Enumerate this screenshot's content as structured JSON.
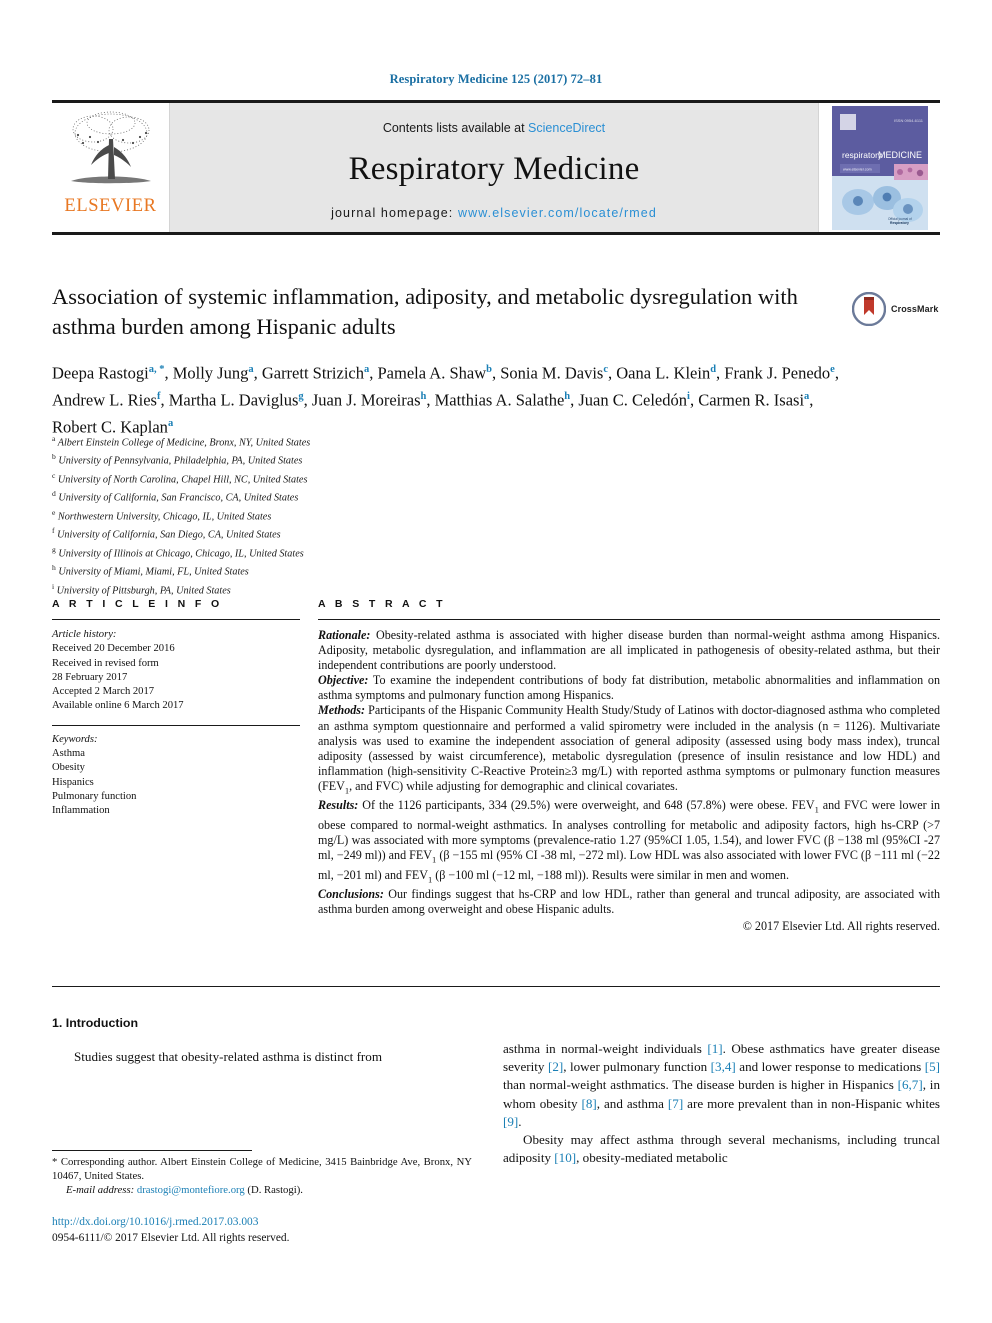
{
  "running_head": "Respiratory Medicine 125 (2017) 72–81",
  "masthead": {
    "publisher_word": "ELSEVIER",
    "contents_prefix": "Contents lists available at ",
    "contents_link": "ScienceDirect",
    "journal_title": "Respiratory Medicine",
    "homepage_prefix": "journal homepage: ",
    "homepage_url": "www.elsevier.com/locate/rmed",
    "cover_title": "respiratory MEDICINE",
    "colors": {
      "elsevier_orange": "#E87722",
      "link_blue": "#2a8fd4",
      "masthead_bg": "#e6e6e6",
      "cover_purple": "#5c5ca0"
    }
  },
  "article": {
    "title": "Association of systemic inflammation, adiposity, and metabolic dysregulation with asthma burden among Hispanic adults",
    "crossmark_label": "CrossMark",
    "authors": [
      {
        "name": "Deepa Rastogi",
        "sup": "a, *"
      },
      {
        "name": "Molly Jung",
        "sup": "a"
      },
      {
        "name": "Garrett Strizich",
        "sup": "a"
      },
      {
        "name": "Pamela A. Shaw",
        "sup": "b"
      },
      {
        "name": "Sonia M. Davis",
        "sup": "c"
      },
      {
        "name": "Oana L. Klein",
        "sup": "d"
      },
      {
        "name": "Frank J. Penedo",
        "sup": "e"
      },
      {
        "name": "Andrew L. Ries",
        "sup": "f"
      },
      {
        "name": "Martha L. Daviglus",
        "sup": "g"
      },
      {
        "name": "Juan J. Moreiras",
        "sup": "h"
      },
      {
        "name": "Matthias A. Salathe",
        "sup": "h"
      },
      {
        "name": "Juan C. Celedón",
        "sup": "i"
      },
      {
        "name": "Carmen R. Isasi",
        "sup": "a"
      },
      {
        "name": "Robert C. Kaplan",
        "sup": "a"
      }
    ],
    "affiliations": [
      {
        "mark": "a",
        "text": "Albert Einstein College of Medicine, Bronx, NY, United States"
      },
      {
        "mark": "b",
        "text": "University of Pennsylvania, Philadelphia, PA, United States"
      },
      {
        "mark": "c",
        "text": "University of North Carolina, Chapel Hill, NC, United States"
      },
      {
        "mark": "d",
        "text": "University of California, San Francisco, CA, United States"
      },
      {
        "mark": "e",
        "text": "Northwestern University, Chicago, IL, United States"
      },
      {
        "mark": "f",
        "text": "University of California, San Diego, CA, United States"
      },
      {
        "mark": "g",
        "text": "University of Illinois at Chicago, Chicago, IL, United States"
      },
      {
        "mark": "h",
        "text": "University of Miami, Miami, FL, United States"
      },
      {
        "mark": "i",
        "text": "University of Pittsburgh, PA, United States"
      }
    ]
  },
  "article_info": {
    "heading": "A R T I C L E  I N F O",
    "history_label": "Article history:",
    "history": [
      "Received 20 December 2016",
      "Received in revised form",
      "28 February 2017",
      "Accepted 2 March 2017",
      "Available online 6 March 2017"
    ],
    "keywords_label": "Keywords:",
    "keywords": [
      "Asthma",
      "Obesity",
      "Hispanics",
      "Pulmonary function",
      "Inflammation"
    ]
  },
  "abstract": {
    "heading": "A B S T R A C T",
    "sections": [
      {
        "lead": "Rationale:",
        "text": " Obesity-related asthma is associated with higher disease burden than normal-weight asthma among Hispanics. Adiposity, metabolic dysregulation, and inflammation are all implicated in pathogenesis of obesity-related asthma, but their independent contributions are poorly understood."
      },
      {
        "lead": "Objective:",
        "text": " To examine the independent contributions of body fat distribution, metabolic abnormalities and inflammation on asthma symptoms and pulmonary function among Hispanics."
      },
      {
        "lead": "Methods:",
        "text": " Participants of the Hispanic Community Health Study/Study of Latinos with doctor-diagnosed asthma who completed an asthma symptom questionnaire and performed a valid spirometry were included in the analysis (n = 1126). Multivariate analysis was used to examine the independent association of general adiposity (assessed using body mass index), truncal adiposity (assessed by waist circumference), metabolic dysregulation (presence of insulin resistance and low HDL) and inflammation (high-sensitivity C-Reactive Protein≥3 mg/L) with reported asthma symptoms or pulmonary function measures (FEV1, and FVC) while adjusting for demographic and clinical covariates."
      },
      {
        "lead": "Results:",
        "text": " Of the 1126 participants, 334 (29.5%) were overweight, and 648 (57.8%) were obese. FEV1 and FVC were lower in obese compared to normal-weight asthmatics. In analyses controlling for metabolic and adiposity factors, high hs-CRP (>7 mg/L) was associated with more symptoms (prevalence-ratio 1.27 (95%CI 1.05, 1.54), and lower FVC (β −138 ml (95%CI -27 ml, −249 ml)) and FEV1 (β −155 ml (95% CI -38 ml, −272 ml). Low HDL was also associated with lower FVC (β −111 ml (−22 ml, −201 ml) and FEV1 (β −100 ml (−12 ml, −188 ml)). Results were similar in men and women."
      },
      {
        "lead": "Conclusions:",
        "text": " Our findings suggest that hs-CRP and low HDL, rather than general and truncal adiposity, are associated with asthma burden among overweight and obese Hispanic adults."
      }
    ],
    "copyright": "© 2017 Elsevier Ltd. All rights reserved."
  },
  "body": {
    "section_number_title": "1. Introduction",
    "left_paragraph": "Studies suggest that obesity-related asthma is distinct from",
    "right_paragraph_1": "asthma in normal-weight individuals [1]. Obese asthmatics have greater disease severity [2], lower pulmonary function [3,4] and lower response to medications [5] than normal-weight asthmatics. The disease burden is higher in Hispanics [6,7], in whom obesity [8], and asthma [7] are more prevalent than in non-Hispanic whites [9].",
    "right_paragraph_2": "Obesity may affect asthma through several mechanisms, including truncal adiposity [10], obesity-mediated metabolic"
  },
  "footnote": {
    "corresponding": "* Corresponding author. Albert Einstein College of Medicine, 3415 Bainbridge Ave, Bronx, NY 10467, United States.",
    "email_label": "E-mail address:",
    "email": "drastogi@montefiore.org",
    "email_owner": " (D. Rastogi).",
    "doi": "http://dx.doi.org/10.1016/j.rmed.2017.03.003",
    "issn": "0954-6111/© 2017 Elsevier Ltd. All rights reserved."
  }
}
